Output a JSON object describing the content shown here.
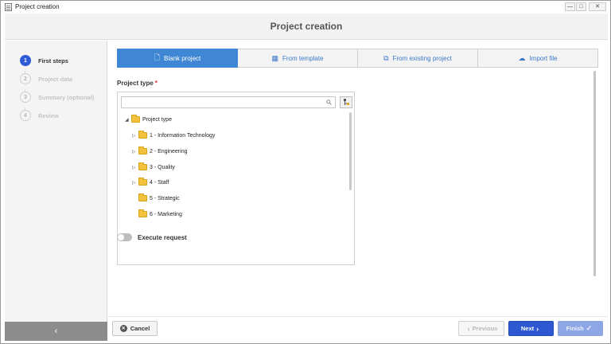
{
  "window": {
    "title": "Project creation",
    "controls": {
      "minimize": "—",
      "maximize": "□",
      "close": "✕"
    }
  },
  "header": {
    "title": "Project creation"
  },
  "steps": [
    {
      "number": "1",
      "label": "First steps",
      "active": true
    },
    {
      "number": "2",
      "label": "Project data",
      "active": false
    },
    {
      "number": "3",
      "label": "Summary (optional)",
      "active": false
    },
    {
      "number": "4",
      "label": "Review",
      "active": false
    }
  ],
  "sidebar": {
    "collapse_icon": "chevron-left-icon",
    "collapse_glyph": "‹"
  },
  "tabs": [
    {
      "label": "Blank project",
      "icon": "document-icon",
      "glyph": "🗋",
      "active": true
    },
    {
      "label": "From template",
      "icon": "grid-icon",
      "glyph": "▦",
      "active": false
    },
    {
      "label": "From existing project",
      "icon": "copy-icon",
      "glyph": "⧉",
      "active": false
    },
    {
      "label": "Import file",
      "icon": "cloud-upload-icon",
      "glyph": "☁",
      "active": false
    }
  ],
  "project_type": {
    "label": "Project type",
    "required_mark": "*",
    "search": {
      "value": "",
      "placeholder": ""
    },
    "tree": {
      "root": {
        "label": "Project type",
        "expanded": true
      },
      "children": [
        {
          "label": "1 - Information Technology",
          "expandable": true
        },
        {
          "label": "2 - Engineering",
          "expandable": true
        },
        {
          "label": "3 - Quality",
          "expandable": true
        },
        {
          "label": "4 - Staff",
          "expandable": true
        },
        {
          "label": "5 - Strategic",
          "expandable": false
        },
        {
          "label": "6 - Marketing",
          "expandable": false
        }
      ]
    }
  },
  "execute_request": {
    "label": "Execute request",
    "on": false
  },
  "footer": {
    "cancel": "Cancel",
    "previous": "Previous",
    "next": "Next",
    "finish": "Finish"
  },
  "colors": {
    "accent": "#2d58d1",
    "tab_active": "#3f86d4",
    "finish_disabled": "#8fa6e4",
    "required": "#d82b2b",
    "folder": "#f2c23f"
  }
}
